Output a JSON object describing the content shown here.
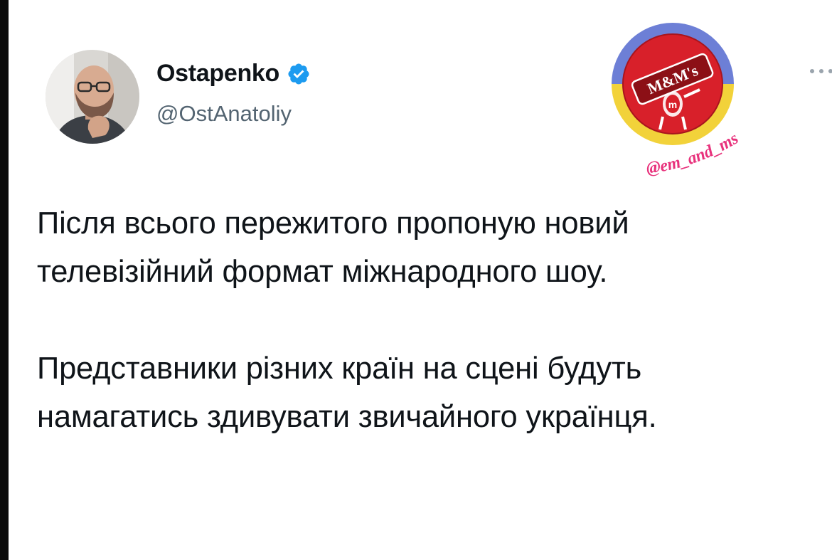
{
  "tweet": {
    "author": {
      "display_name": "Ostapenko",
      "handle": "@OstAnatoliy",
      "verified": true,
      "verified_color": "#1d9bf0"
    },
    "more_icon": "more-horizontal-icon",
    "paragraphs": [
      {
        "lines": [
          "Після всього пережитого пропоную новий",
          "телевізійний формат міжнародного шоу."
        ]
      },
      {
        "lines": [
          "Представники різних країн на сцені будуть",
          "намагатись здивувати звичайного українця."
        ]
      }
    ]
  },
  "watermark": {
    "logo_text": "M&M's",
    "handle": "@em_and_ms",
    "colors": {
      "ring_blue": "#6d7fd6",
      "ring_yellow": "#f2d23a",
      "badge_red": "#d8202a",
      "text_pink": "#e8327c"
    }
  },
  "edge_color": "#0a0a0a"
}
